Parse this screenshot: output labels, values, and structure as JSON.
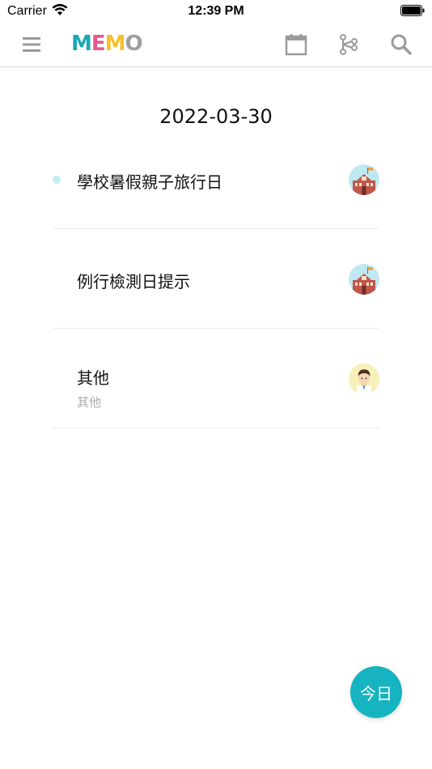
{
  "status_bar": {
    "carrier": "Carrier",
    "time": "12:39 PM"
  },
  "nav": {
    "logo_letters": [
      "M",
      "E",
      "M",
      "O"
    ],
    "logo_colors": [
      "#1aa8b4",
      "#e8578a",
      "#f5c12a",
      "#9e9e9e"
    ],
    "icons": [
      "menu-icon",
      "calendar-icon",
      "branch-icon",
      "search-icon"
    ]
  },
  "date": "2022-03-30",
  "memos": [
    {
      "title": "學校暑假親子旅行日",
      "subtitle": "",
      "unread": true,
      "avatar": "school-avatar"
    },
    {
      "title": "例行檢測日提示",
      "subtitle": "",
      "unread": false,
      "avatar": "school-avatar"
    },
    {
      "title": "其他",
      "subtitle": "其他",
      "unread": false,
      "avatar": "person-avatar"
    }
  ],
  "today_button": "今日",
  "colors": {
    "accent": "#16b4c0",
    "unread_dot": "#bfeef4",
    "icon_gray": "#9a9a9a"
  }
}
